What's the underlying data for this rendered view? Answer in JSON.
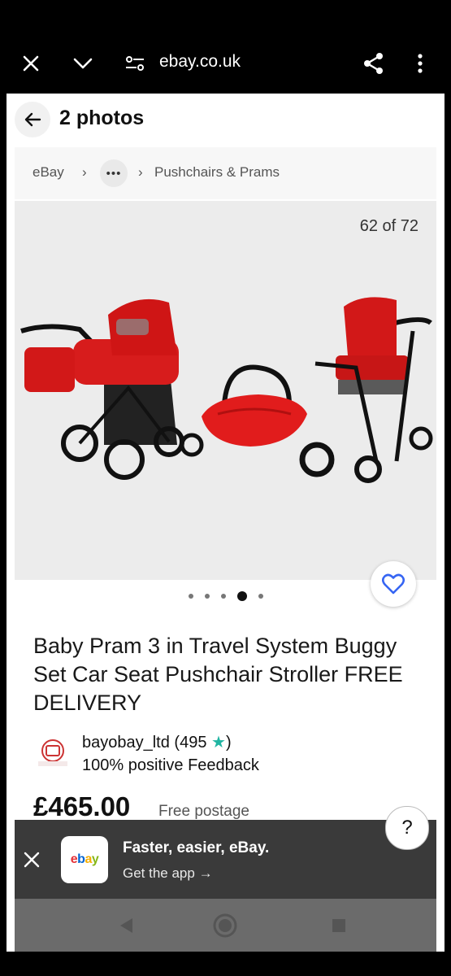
{
  "browser": {
    "url": "ebay.co.uk",
    "icons": [
      "close-icon",
      "chevron-down-icon",
      "site-settings-icon",
      "share-icon",
      "more-vertical-icon"
    ]
  },
  "header": {
    "title": "2 photos"
  },
  "breadcrumb": {
    "root": "eBay",
    "more": "•••",
    "category": "Pushchairs & Prams"
  },
  "gallery": {
    "counter": "62 of 72",
    "dots_total": 5,
    "active_dot": 4,
    "image_subject": "red pram travel system"
  },
  "listing": {
    "title": "Baby Pram 3 in Travel System Buggy Set Car Seat Pushchair Stroller FREE DELIVERY",
    "seller": "bayobay_ltd (495",
    "seller_feedback": "100% positive Feedback",
    "price": "£465.00",
    "postage": "Free postage"
  },
  "help_button": "?",
  "app_banner": {
    "icon_text": "ebay",
    "title": "Faster, easier, eBay.",
    "subtitle": "Get the app →"
  },
  "colors": {
    "ebay_red": "#e53238",
    "ebay_blue": "#0064d2",
    "ebay_yellow": "#f5af02",
    "ebay_green": "#86b817",
    "star_teal": "#21b5a2",
    "watch_blue": "#3665f3"
  }
}
